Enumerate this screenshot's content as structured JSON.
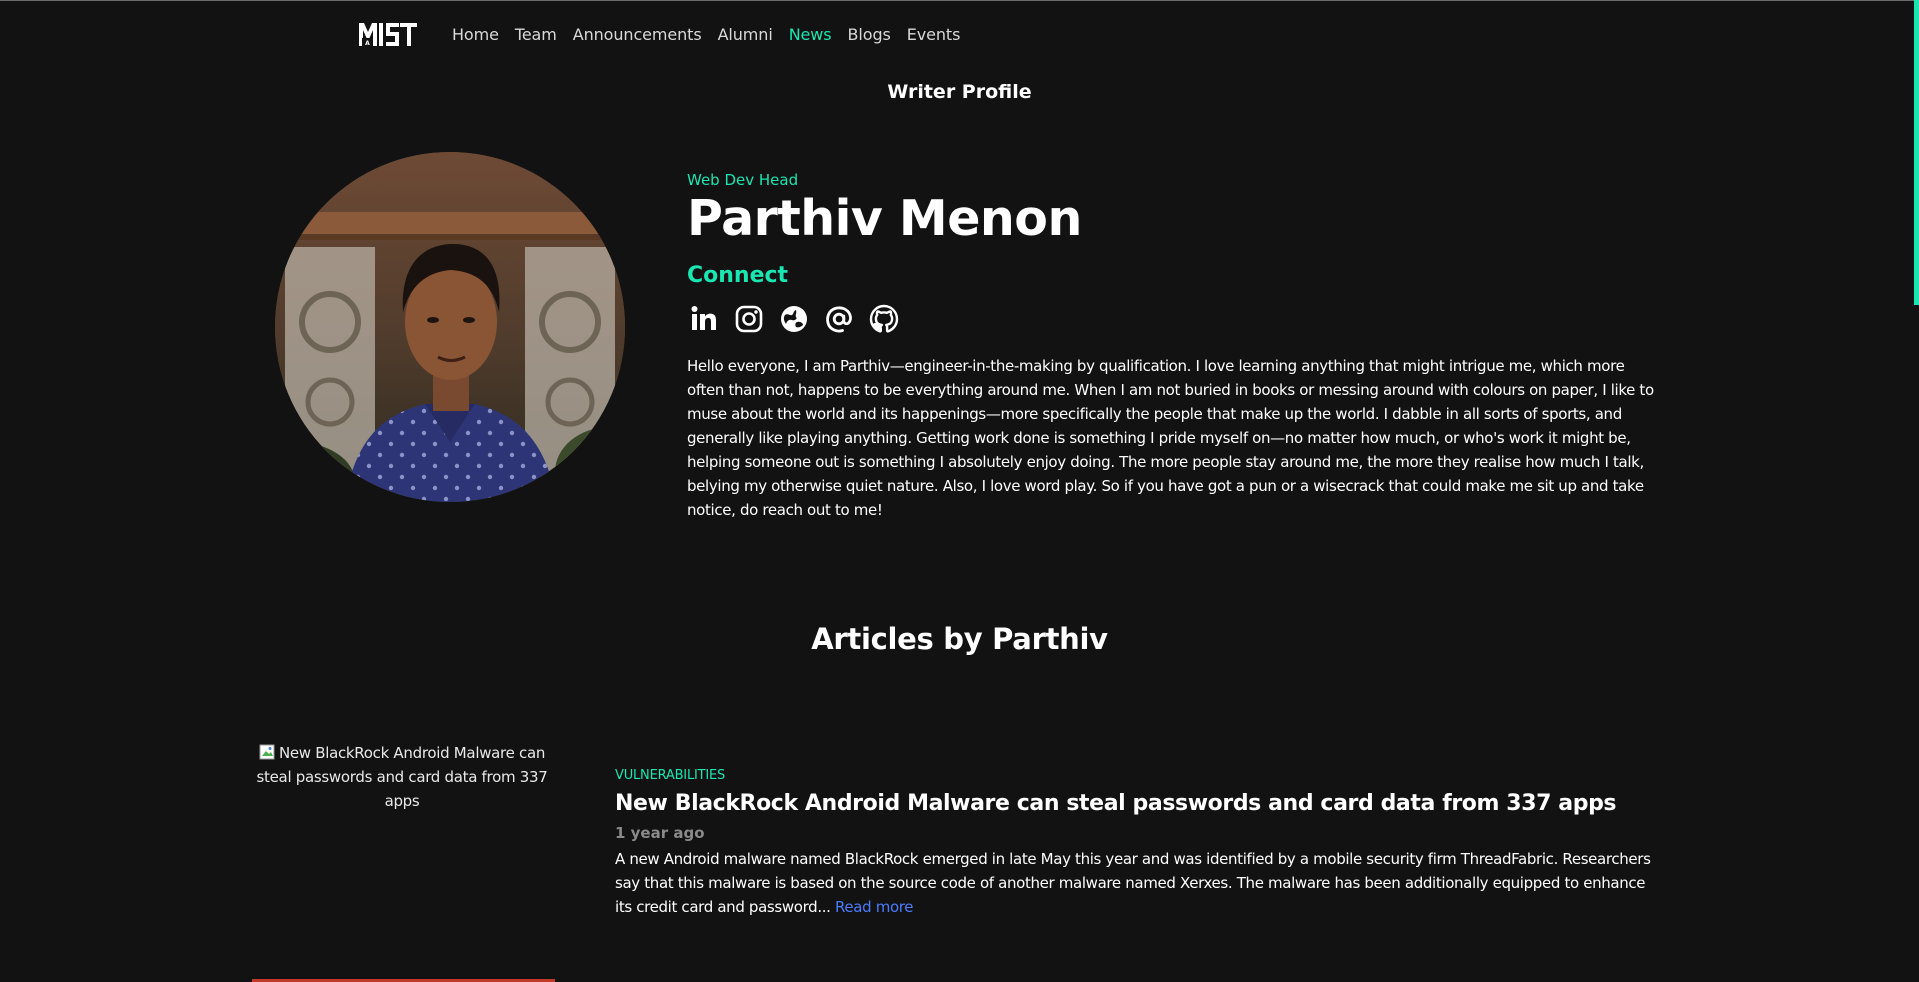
{
  "colors": {
    "background": "#121212",
    "accent": "#19e6b0",
    "link": "#4a7cff",
    "muted": "#8a8a8a"
  },
  "nav": {
    "logo_alt": "MIST",
    "links": [
      "Home",
      "Team",
      "Announcements",
      "Alumni",
      "News",
      "Blogs",
      "Events"
    ],
    "active": "News"
  },
  "page_title": "Writer Profile",
  "profile": {
    "role": "Web Dev Head",
    "name": "Parthiv Menon",
    "connect_label": "Connect",
    "socials": [
      {
        "icon": "linkedin-icon"
      },
      {
        "icon": "instagram-icon"
      },
      {
        "icon": "website-globe-icon"
      },
      {
        "icon": "email-at-icon"
      },
      {
        "icon": "github-icon"
      }
    ],
    "bio": "Hello everyone, I am Parthiv—engineer-in-the-making by qualification. I love learning anything that might intrigue me, which more often than not, happens to be everything around me. When I am not buried in books or messing around with colours on paper, I like to muse about the world and its happenings—more specifically the people that make up the world. I dabble in all sorts of sports, and generally like playing anything. Getting work done is something I pride myself on—no matter how much, or who's work it might be, helping someone out is something I absolutely enjoy doing. The more people stay around me, the more they realise how much I talk, belying my otherwise quiet nature. Also, I love word play. So if you have got a pun or a wisecrack that could make me sit up and take notice, do reach out to me!"
  },
  "articles_heading": "Articles by Parthiv",
  "articles": [
    {
      "image_alt": "New BlackRock Android Malware can steal passwords and card data from 337 apps",
      "category": "VULNERABILITIES",
      "title": "New BlackRock Android Malware can steal passwords and card data from 337 apps",
      "time": "1 year ago",
      "excerpt": "A new Android malware named BlackRock emerged in late May this year and was identified by a mobile security firm ThreadFabric. Researchers say that this malware is based on the source code of another malware named Xerxes. The malware has been additionally equipped to enhance its credit card and password...",
      "read_more": "Read more"
    }
  ]
}
